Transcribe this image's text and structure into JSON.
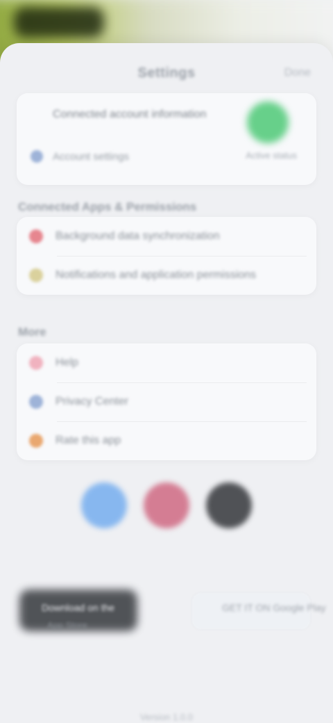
{
  "header": {
    "title": "Settings",
    "action": "Done"
  },
  "account": {
    "line": "Connected account information",
    "sub": "Account settings",
    "badge_label": "Active status"
  },
  "sections": {
    "privacy_title": "Connected Apps & Permissions",
    "privacy_items": [
      {
        "label": "Background data synchronization",
        "icon": "shield-icon",
        "color": "#e6868f"
      },
      {
        "label": "Notifications and application permissions",
        "icon": "lock-icon",
        "color": "#dad19d"
      }
    ],
    "more_title": "More",
    "more_items": [
      {
        "label": "Help",
        "icon": "heart-icon",
        "color": "#f0b2bf"
      },
      {
        "label": "Privacy Center",
        "icon": "privacy-icon",
        "color": "#9eb3d8"
      },
      {
        "label": "Rate this app",
        "icon": "star-icon",
        "color": "#e9a76f"
      }
    ]
  },
  "social": {
    "left": "facebook-icon",
    "mid": "instagram-icon",
    "right": "camera-icon"
  },
  "stores": {
    "left_title": "Download on the",
    "left_sub": "App Store",
    "right_title": "GET IT ON Google Play"
  },
  "footer": "Version 1.0.0"
}
